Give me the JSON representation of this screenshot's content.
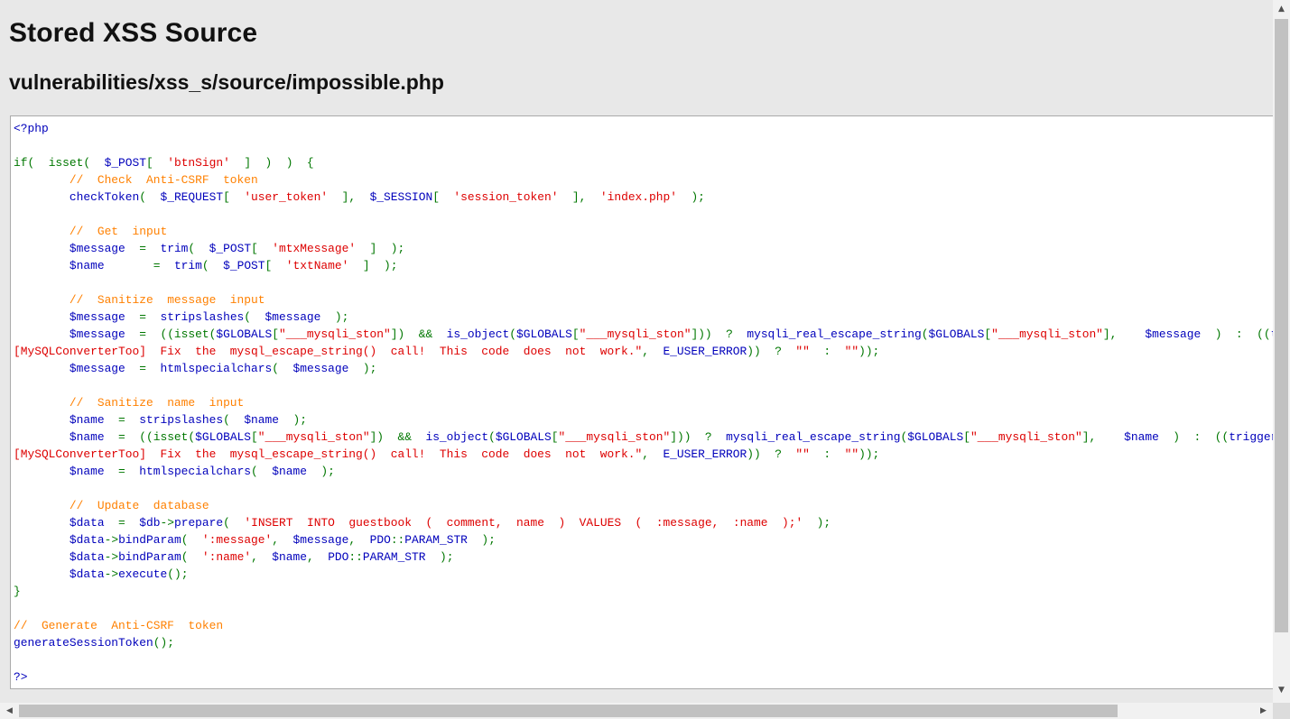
{
  "page": {
    "title": "Stored XSS Source",
    "file_path": "vulnerabilities/xss_s/source/impossible.php"
  },
  "colors": {
    "keyword": "#007700",
    "variable": "#0000bb",
    "string": "#dd0000",
    "comment": "#ff8000",
    "background": "#e8e8e8"
  },
  "icons": {
    "scroll_up": "scroll-up-arrow-icon",
    "scroll_down": "scroll-down-arrow-icon",
    "scroll_left": "scroll-left-arrow-icon",
    "scroll_right": "scroll-right-arrow-icon"
  },
  "code_lines": [
    [
      {
        "c": "v",
        "t": "<?php"
      }
    ],
    [],
    [
      {
        "c": "k",
        "t": "if(  "
      },
      {
        "c": "k",
        "t": "isset(  "
      },
      {
        "c": "v",
        "t": "$_POST"
      },
      {
        "c": "k",
        "t": "[  "
      },
      {
        "c": "s",
        "t": "'btnSign'"
      },
      {
        "c": "k",
        "t": "  ]  )  )  {"
      }
    ],
    [
      {
        "c": "k",
        "t": "        "
      },
      {
        "c": "c",
        "t": "//  Check  Anti-CSRF  token"
      }
    ],
    [
      {
        "c": "k",
        "t": "        "
      },
      {
        "c": "v",
        "t": "checkToken"
      },
      {
        "c": "k",
        "t": "(  "
      },
      {
        "c": "v",
        "t": "$_REQUEST"
      },
      {
        "c": "k",
        "t": "[  "
      },
      {
        "c": "s",
        "t": "'user_token'"
      },
      {
        "c": "k",
        "t": "  ],  "
      },
      {
        "c": "v",
        "t": "$_SESSION"
      },
      {
        "c": "k",
        "t": "[  "
      },
      {
        "c": "s",
        "t": "'session_token'"
      },
      {
        "c": "k",
        "t": "  ],  "
      },
      {
        "c": "s",
        "t": "'index.php'"
      },
      {
        "c": "k",
        "t": "  );"
      }
    ],
    [],
    [
      {
        "c": "k",
        "t": "        "
      },
      {
        "c": "c",
        "t": "//  Get  input"
      }
    ],
    [
      {
        "c": "k",
        "t": "        "
      },
      {
        "c": "v",
        "t": "$message  "
      },
      {
        "c": "k",
        "t": "=  "
      },
      {
        "c": "v",
        "t": "trim"
      },
      {
        "c": "k",
        "t": "(  "
      },
      {
        "c": "v",
        "t": "$_POST"
      },
      {
        "c": "k",
        "t": "[  "
      },
      {
        "c": "s",
        "t": "'mtxMessage'"
      },
      {
        "c": "k",
        "t": "  ]  );"
      }
    ],
    [
      {
        "c": "k",
        "t": "        "
      },
      {
        "c": "v",
        "t": "$name       "
      },
      {
        "c": "k",
        "t": "=  "
      },
      {
        "c": "v",
        "t": "trim"
      },
      {
        "c": "k",
        "t": "(  "
      },
      {
        "c": "v",
        "t": "$_POST"
      },
      {
        "c": "k",
        "t": "[  "
      },
      {
        "c": "s",
        "t": "'txtName'"
      },
      {
        "c": "k",
        "t": "  ]  );"
      }
    ],
    [],
    [
      {
        "c": "k",
        "t": "        "
      },
      {
        "c": "c",
        "t": "//  Sanitize  message  input"
      }
    ],
    [
      {
        "c": "k",
        "t": "        "
      },
      {
        "c": "v",
        "t": "$message  "
      },
      {
        "c": "k",
        "t": "=  "
      },
      {
        "c": "v",
        "t": "stripslashes"
      },
      {
        "c": "k",
        "t": "(  "
      },
      {
        "c": "v",
        "t": "$message  "
      },
      {
        "c": "k",
        "t": ");"
      }
    ],
    [
      {
        "c": "k",
        "t": "        "
      },
      {
        "c": "v",
        "t": "$message  "
      },
      {
        "c": "k",
        "t": "=  ((isset("
      },
      {
        "c": "v",
        "t": "$GLOBALS"
      },
      {
        "c": "k",
        "t": "["
      },
      {
        "c": "s",
        "t": "\"___mysqli_ston\""
      },
      {
        "c": "k",
        "t": "])  &&  "
      },
      {
        "c": "v",
        "t": "is_object"
      },
      {
        "c": "k",
        "t": "("
      },
      {
        "c": "v",
        "t": "$GLOBALS"
      },
      {
        "c": "k",
        "t": "["
      },
      {
        "c": "s",
        "t": "\"___mysqli_ston\""
      },
      {
        "c": "k",
        "t": "]))  ?  "
      },
      {
        "c": "v",
        "t": "mysqli_real_escape_string"
      },
      {
        "c": "k",
        "t": "("
      },
      {
        "c": "v",
        "t": "$GLOBALS"
      },
      {
        "c": "k",
        "t": "["
      },
      {
        "c": "s",
        "t": "\"___mysqli_ston\""
      },
      {
        "c": "k",
        "t": "],    "
      },
      {
        "c": "v",
        "t": "$message  "
      },
      {
        "c": "k",
        "t": ")  :  (("
      },
      {
        "c": "v",
        "t": "trigger_error"
      }
    ],
    [
      {
        "c": "s",
        "t": "[MySQLConverterToo]  Fix  the  mysql_escape_string()  call!  This  code  does  not  work.\""
      },
      {
        "c": "k",
        "t": ",  "
      },
      {
        "c": "v",
        "t": "E_USER_ERROR"
      },
      {
        "c": "k",
        "t": "))  ?  "
      },
      {
        "c": "s",
        "t": "\"\""
      },
      {
        "c": "k",
        "t": "  :  "
      },
      {
        "c": "s",
        "t": "\"\""
      },
      {
        "c": "k",
        "t": "));"
      }
    ],
    [
      {
        "c": "k",
        "t": "        "
      },
      {
        "c": "v",
        "t": "$message  "
      },
      {
        "c": "k",
        "t": "=  "
      },
      {
        "c": "v",
        "t": "htmlspecialchars"
      },
      {
        "c": "k",
        "t": "(  "
      },
      {
        "c": "v",
        "t": "$message  "
      },
      {
        "c": "k",
        "t": ");"
      }
    ],
    [],
    [
      {
        "c": "k",
        "t": "        "
      },
      {
        "c": "c",
        "t": "//  Sanitize  name  input"
      }
    ],
    [
      {
        "c": "k",
        "t": "        "
      },
      {
        "c": "v",
        "t": "$name  "
      },
      {
        "c": "k",
        "t": "=  "
      },
      {
        "c": "v",
        "t": "stripslashes"
      },
      {
        "c": "k",
        "t": "(  "
      },
      {
        "c": "v",
        "t": "$name  "
      },
      {
        "c": "k",
        "t": ");"
      }
    ],
    [
      {
        "c": "k",
        "t": "        "
      },
      {
        "c": "v",
        "t": "$name  "
      },
      {
        "c": "k",
        "t": "=  ((isset("
      },
      {
        "c": "v",
        "t": "$GLOBALS"
      },
      {
        "c": "k",
        "t": "["
      },
      {
        "c": "s",
        "t": "\"___mysqli_ston\""
      },
      {
        "c": "k",
        "t": "])  &&  "
      },
      {
        "c": "v",
        "t": "is_object"
      },
      {
        "c": "k",
        "t": "("
      },
      {
        "c": "v",
        "t": "$GLOBALS"
      },
      {
        "c": "k",
        "t": "["
      },
      {
        "c": "s",
        "t": "\"___mysqli_ston\""
      },
      {
        "c": "k",
        "t": "]))  ?  "
      },
      {
        "c": "v",
        "t": "mysqli_real_escape_string"
      },
      {
        "c": "k",
        "t": "("
      },
      {
        "c": "v",
        "t": "$GLOBALS"
      },
      {
        "c": "k",
        "t": "["
      },
      {
        "c": "s",
        "t": "\"___mysqli_ston\""
      },
      {
        "c": "k",
        "t": "],    "
      },
      {
        "c": "v",
        "t": "$name  "
      },
      {
        "c": "k",
        "t": ")  :  (("
      },
      {
        "c": "v",
        "t": "trigger_error"
      }
    ],
    [
      {
        "c": "s",
        "t": "[MySQLConverterToo]  Fix  the  mysql_escape_string()  call!  This  code  does  not  work.\""
      },
      {
        "c": "k",
        "t": ",  "
      },
      {
        "c": "v",
        "t": "E_USER_ERROR"
      },
      {
        "c": "k",
        "t": "))  ?  "
      },
      {
        "c": "s",
        "t": "\"\""
      },
      {
        "c": "k",
        "t": "  :  "
      },
      {
        "c": "s",
        "t": "\"\""
      },
      {
        "c": "k",
        "t": "));"
      }
    ],
    [
      {
        "c": "k",
        "t": "        "
      },
      {
        "c": "v",
        "t": "$name  "
      },
      {
        "c": "k",
        "t": "=  "
      },
      {
        "c": "v",
        "t": "htmlspecialchars"
      },
      {
        "c": "k",
        "t": "(  "
      },
      {
        "c": "v",
        "t": "$name  "
      },
      {
        "c": "k",
        "t": ");"
      }
    ],
    [],
    [
      {
        "c": "k",
        "t": "        "
      },
      {
        "c": "c",
        "t": "//  Update  database"
      }
    ],
    [
      {
        "c": "k",
        "t": "        "
      },
      {
        "c": "v",
        "t": "$data  "
      },
      {
        "c": "k",
        "t": "=  "
      },
      {
        "c": "v",
        "t": "$db"
      },
      {
        "c": "k",
        "t": "->"
      },
      {
        "c": "v",
        "t": "prepare"
      },
      {
        "c": "k",
        "t": "(  "
      },
      {
        "c": "s",
        "t": "'INSERT  INTO  guestbook  (  comment,  name  )  VALUES  (  :message,  :name  );'"
      },
      {
        "c": "k",
        "t": "  );"
      }
    ],
    [
      {
        "c": "k",
        "t": "        "
      },
      {
        "c": "v",
        "t": "$data"
      },
      {
        "c": "k",
        "t": "->"
      },
      {
        "c": "v",
        "t": "bindParam"
      },
      {
        "c": "k",
        "t": "(  "
      },
      {
        "c": "s",
        "t": "':message'"
      },
      {
        "c": "k",
        "t": ",  "
      },
      {
        "c": "v",
        "t": "$message"
      },
      {
        "c": "k",
        "t": ",  "
      },
      {
        "c": "v",
        "t": "PDO"
      },
      {
        "c": "k",
        "t": "::"
      },
      {
        "c": "v",
        "t": "PARAM_STR  "
      },
      {
        "c": "k",
        "t": ");"
      }
    ],
    [
      {
        "c": "k",
        "t": "        "
      },
      {
        "c": "v",
        "t": "$data"
      },
      {
        "c": "k",
        "t": "->"
      },
      {
        "c": "v",
        "t": "bindParam"
      },
      {
        "c": "k",
        "t": "(  "
      },
      {
        "c": "s",
        "t": "':name'"
      },
      {
        "c": "k",
        "t": ",  "
      },
      {
        "c": "v",
        "t": "$name"
      },
      {
        "c": "k",
        "t": ",  "
      },
      {
        "c": "v",
        "t": "PDO"
      },
      {
        "c": "k",
        "t": "::"
      },
      {
        "c": "v",
        "t": "PARAM_STR  "
      },
      {
        "c": "k",
        "t": ");"
      }
    ],
    [
      {
        "c": "k",
        "t": "        "
      },
      {
        "c": "v",
        "t": "$data"
      },
      {
        "c": "k",
        "t": "->"
      },
      {
        "c": "v",
        "t": "execute"
      },
      {
        "c": "k",
        "t": "();"
      }
    ],
    [
      {
        "c": "k",
        "t": "}"
      }
    ],
    [],
    [
      {
        "c": "c",
        "t": "//  Generate  Anti-CSRF  token"
      }
    ],
    [
      {
        "c": "v",
        "t": "generateSessionToken"
      },
      {
        "c": "k",
        "t": "();"
      }
    ],
    [],
    [
      {
        "c": "v",
        "t": "?>"
      }
    ]
  ]
}
